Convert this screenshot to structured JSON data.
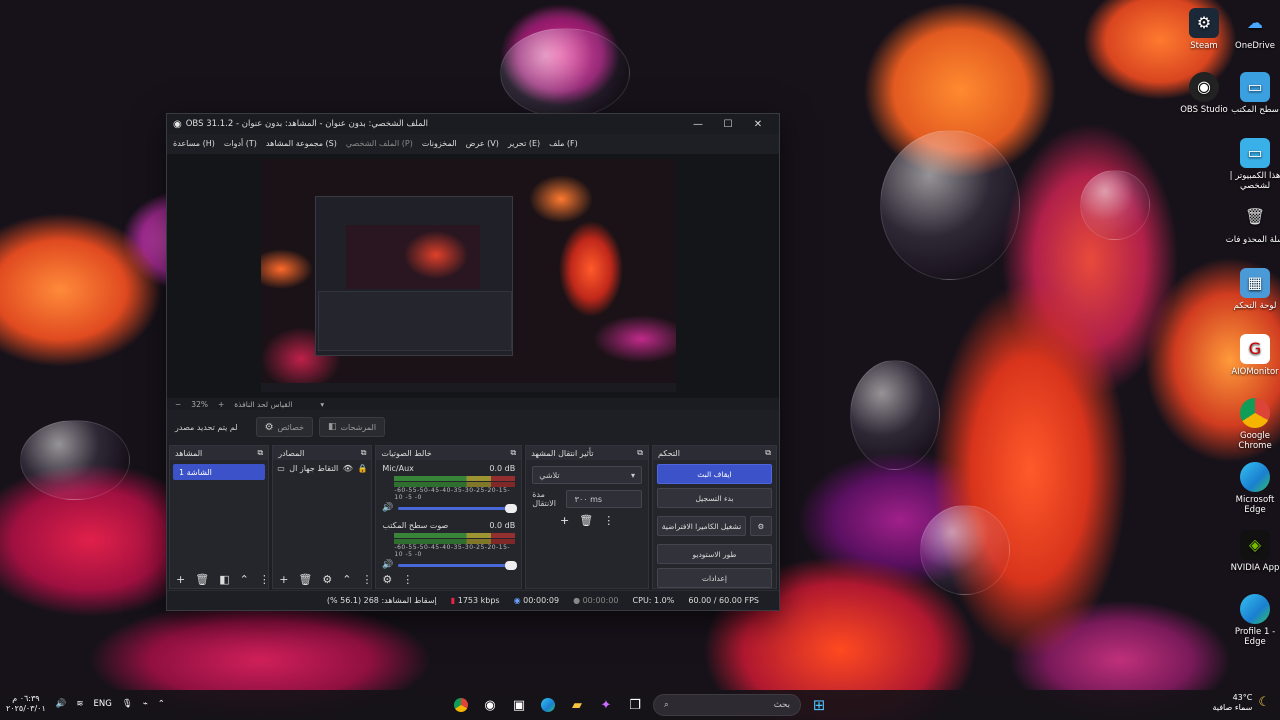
{
  "window": {
    "title": "OBS 31.1.2 - الملف الشخصي: بدون عنوان - المشاهد: بدون عنوان",
    "menu": [
      "ملف (F)",
      "تحرير (E)",
      "عرض (V)",
      "المخزونات",
      "الملف الشخصي (P)",
      "مجموعة المشاهد (S)",
      "أدوات (T)",
      "مساعدة (H)"
    ]
  },
  "preview": {
    "zoom": "32%",
    "fit_label": "القياس لحد النافذة",
    "no_source": "لم يتم تحديد مصدر",
    "properties_label": "خصائص",
    "filters_label": "المرشحات"
  },
  "scenes": {
    "title": "المشاهد",
    "items": [
      "الشاشة 1"
    ]
  },
  "sources": {
    "title": "المصادر",
    "items": [
      "التقاط جهاز ال"
    ]
  },
  "mixer": {
    "title": "خالط الصوتيات",
    "scale": "-60-55-50-45-40-35-30-25-20-15-10 -5 -0",
    "tracks": [
      {
        "name": "Mic/Aux",
        "level": "0.0 dB"
      },
      {
        "name": "صوت سطح المكتب",
        "level": "0.0 dB"
      }
    ]
  },
  "transitions": {
    "title": "تأثير انتقال المشهد",
    "selected": "تلاشي",
    "duration_label": "مدة الانتقال",
    "duration_value": "٣٠٠ ms"
  },
  "controls": {
    "title": "التحكم",
    "buttons": [
      "ايقاف البث",
      "بدء التسجيل",
      "تشغيل الكاميرا الافتراضية",
      "طور الاستوديو",
      "إعدادات"
    ]
  },
  "status": {
    "dropped": "إسقاط المشاهد: 268 (56.1 %)",
    "bitrate": "1753 kbps",
    "stream_time": "00:00:09",
    "rec_time": "00:00:00",
    "cpu": "CPU: 1.0%",
    "fps": "60.00 / 60.00 FPS"
  },
  "desktop_icons": [
    {
      "label": "Steam",
      "icon": "steam-icon"
    },
    {
      "label": "OneDrive",
      "icon": "onedrive-icon"
    },
    {
      "label": "OBS Studio",
      "icon": "obs-icon"
    },
    {
      "label": "سطح المكتب",
      "icon": "folder-icon"
    },
    {
      "label": "هذا الكمبيوتر | لشخصي",
      "icon": "computer-icon"
    },
    {
      "label": "سلة المحذو فات",
      "icon": "recycle-bin-icon"
    },
    {
      "label": "لوحة التحكم",
      "icon": "control-panel-icon"
    },
    {
      "label": "AIOMonitor",
      "icon": "aiomonitor-icon"
    },
    {
      "label": "Google Chrome",
      "icon": "chrome-icon"
    },
    {
      "label": "Microsoft Edge",
      "icon": "edge-icon"
    },
    {
      "label": "NVIDIA App",
      "icon": "nvidia-icon"
    },
    {
      "label": "Profile 1 - Edge",
      "icon": "edge-profile-icon"
    }
  ],
  "taskbar": {
    "search_placeholder": "بحث",
    "lang": "ENG",
    "time": "٠٦:٣٩ م",
    "date": "٢٠٢٥/٠٣/٠١",
    "temp": "43°C",
    "weather": "سماء صافية"
  },
  "colors": {
    "accent": "#3b52c9",
    "window_bg": "#1e1f24"
  }
}
